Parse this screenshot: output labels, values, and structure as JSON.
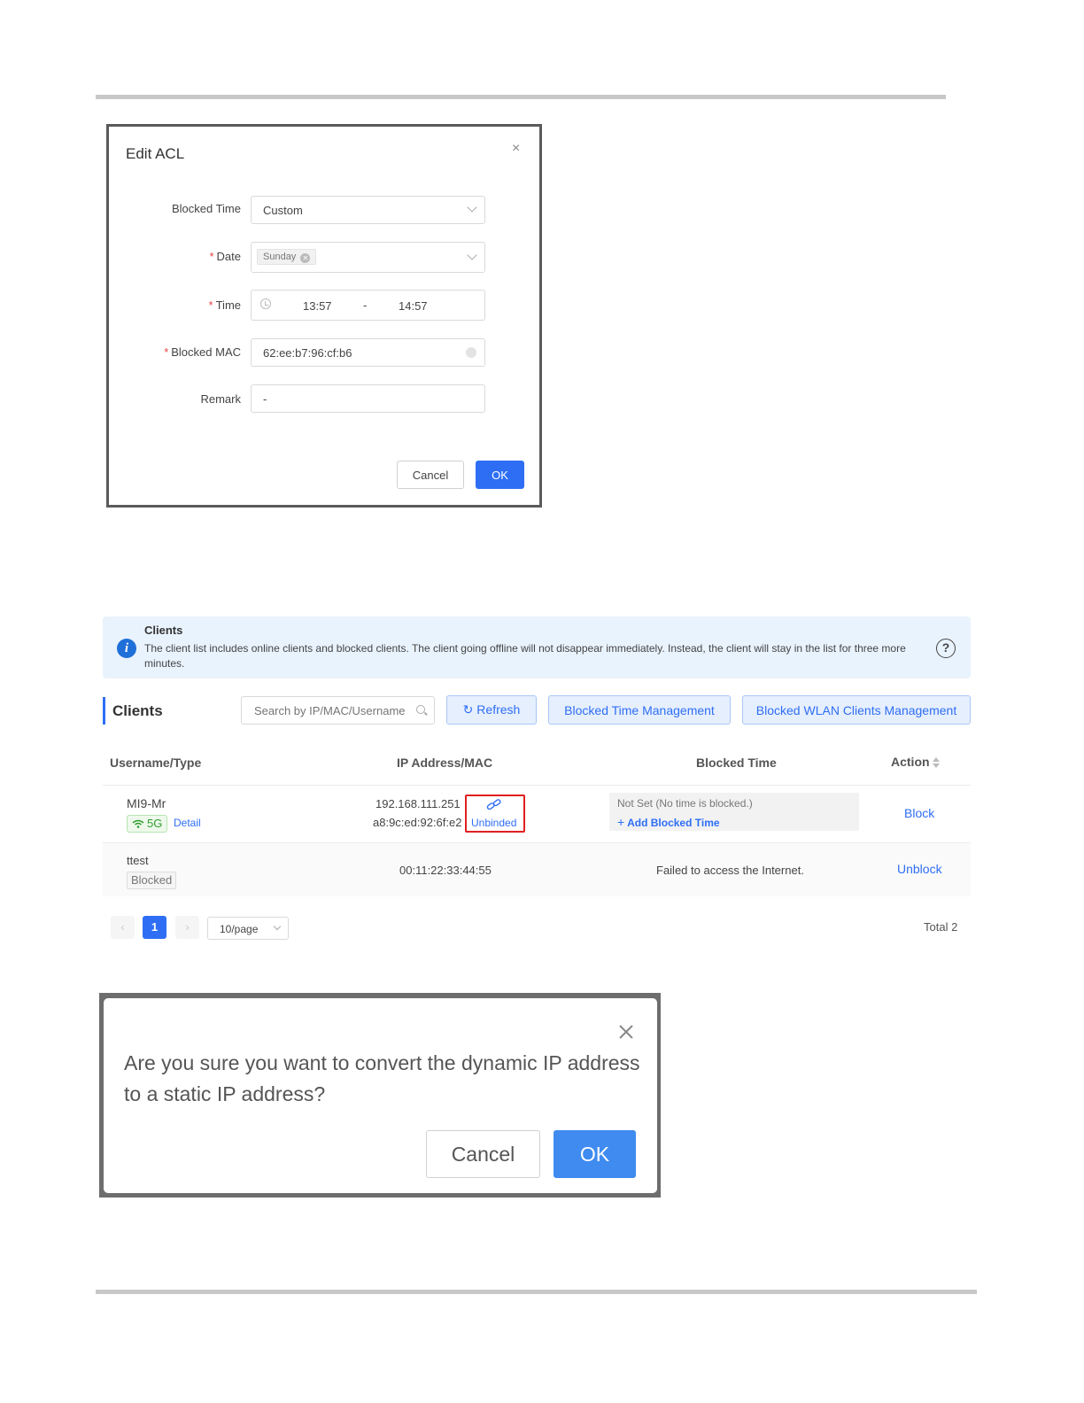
{
  "edit_acl": {
    "title": "Edit ACL",
    "close": "×",
    "blocked_time_label": "Blocked Time",
    "blocked_time_value": "Custom",
    "date_label": "Date",
    "date_tag": "Sunday",
    "time_label": "Time",
    "time_start": "13:57",
    "time_sep": "-",
    "time_end": "14:57",
    "blocked_mac_label": "Blocked MAC",
    "blocked_mac_value": "62:ee:b7:96:cf:b6",
    "remark_label": "Remark",
    "remark_value": "-",
    "required_mark": "*",
    "cancel": "Cancel",
    "ok": "OK"
  },
  "clients": {
    "notice_title": "Clients",
    "notice_text": "The client list includes online clients and blocked clients. The client going offline will not disappear immediately. Instead, the client will stay in the list for three more minutes.",
    "section_title": "Clients",
    "search_placeholder": "Search by IP/MAC/Username",
    "refresh": "Refresh",
    "blocked_time_mgmt": "Blocked Time Management",
    "blocked_wlan_mgmt": "Blocked WLAN Clients Management",
    "columns": [
      "Username/Type",
      "IP Address/MAC",
      "Blocked Time",
      "Action"
    ],
    "rows": [
      {
        "username": "MI9-Mr",
        "band": "5G",
        "detail": "Detail",
        "ip": "192.168.111.251",
        "mac": "a8:9c:ed:92:6f:e2",
        "bind_status": "Unbinded",
        "blocked_time": "Not Set (No time is blocked.)",
        "add_blocked_time": "Add Blocked Time",
        "action": "Block"
      },
      {
        "username": "ttest",
        "type_tag": "Blocked",
        "mac": "00:11:22:33:44:55",
        "blocked_time": "Failed to access the Internet.",
        "action": "Unblock"
      }
    ],
    "pagination": {
      "current_page": "1",
      "page_size": "10/page",
      "total": "Total 2"
    }
  },
  "confirm_dialog": {
    "message": "Are you sure you want to convert the dynamic IP address to a static IP address?",
    "cancel": "Cancel",
    "ok": "OK"
  },
  "colors": {
    "primary": "#2e6ef5",
    "notice_bg": "#e9f3fd",
    "highlight_border": "#e02020",
    "band_green": "#2f9e2f"
  }
}
